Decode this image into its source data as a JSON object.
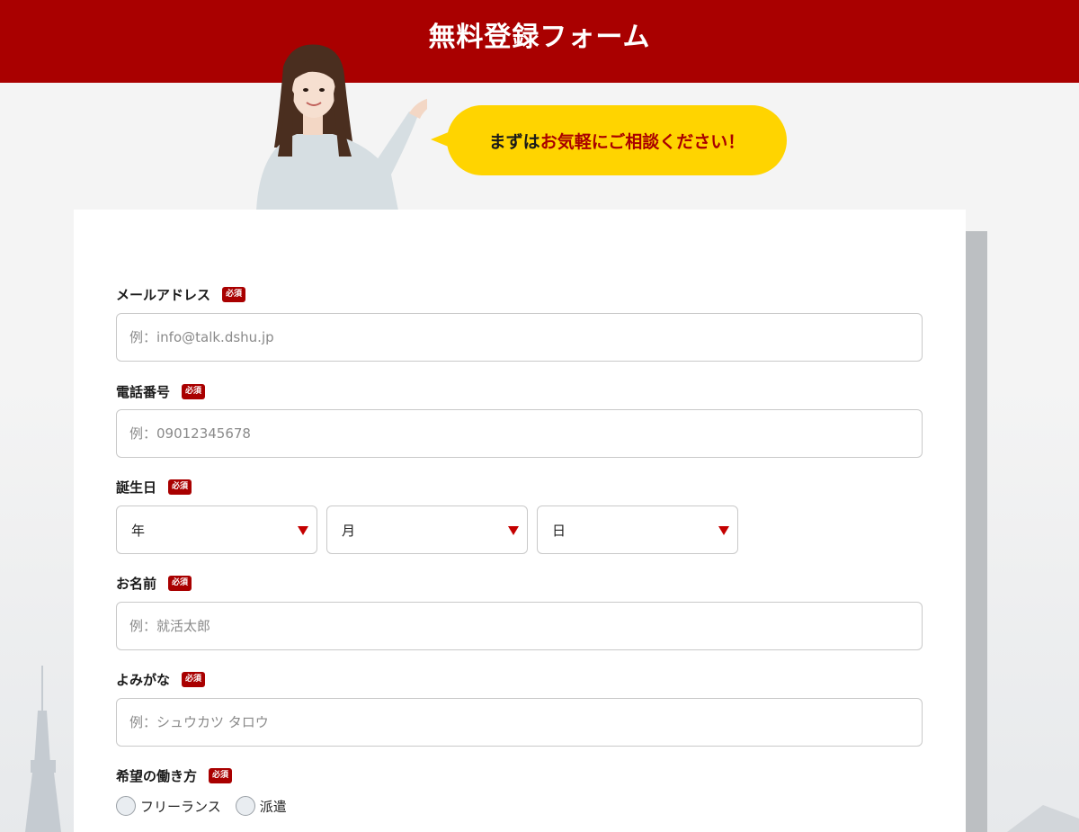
{
  "header": {
    "title": "無料登録フォーム"
  },
  "bubble": {
    "text_prefix": "まずは",
    "text_highlight": "お気軽にご相談ください！"
  },
  "form": {
    "email": {
      "label": "メールアドレス",
      "required": "必須",
      "placeholder": "例：info@talk.dshu.jp"
    },
    "phone": {
      "label": "電話番号",
      "required": "必須",
      "placeholder": "例：09012345678"
    },
    "birthday": {
      "label": "誕生日",
      "required": "必須",
      "year": "年",
      "month": "月",
      "day": "日"
    },
    "name": {
      "label": "お名前",
      "required": "必須",
      "placeholder": "例：就活太郎"
    },
    "kana": {
      "label": "よみがな",
      "required": "必須",
      "placeholder": "例：シュウカツ タロウ"
    },
    "workstyle": {
      "label": "希望の働き方",
      "required": "必須",
      "options": [
        "フリーランス",
        "派遣"
      ]
    }
  },
  "colors": {
    "brand_red": "#a90000",
    "bubble_yellow": "#ffd400"
  }
}
